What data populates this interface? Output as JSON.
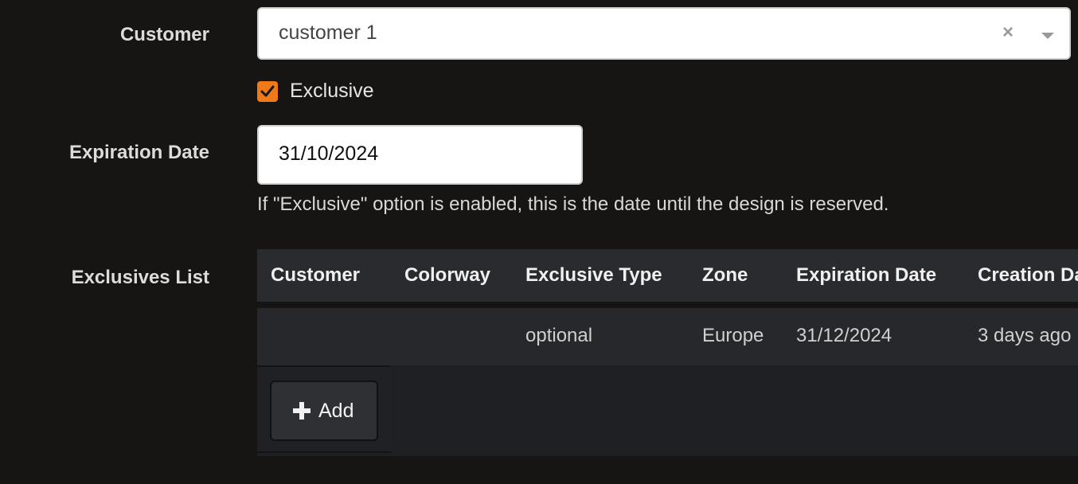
{
  "form": {
    "customer_label": "Customer",
    "customer_value": "customer 1",
    "clear_glyph": "×",
    "exclusive_label": "Exclusive",
    "exclusive_checked": true,
    "expiration_label": "Expiration Date",
    "expiration_value": "31/10/2024",
    "help_text": "If \"Exclusive\" option is enabled, this is the date until the design is reserved.",
    "list_label": "Exclusives List"
  },
  "table": {
    "columns": [
      "Customer",
      "Colorway",
      "Exclusive Type",
      "Zone",
      "Expiration Date",
      "Creation Date"
    ],
    "rows": [
      [
        "",
        "",
        "optional",
        "Europe",
        "31/12/2024",
        "3 days ago"
      ]
    ]
  },
  "actions": {
    "add_label": "Add"
  },
  "colors": {
    "background": "#161514",
    "accent": "#f07a1a"
  }
}
